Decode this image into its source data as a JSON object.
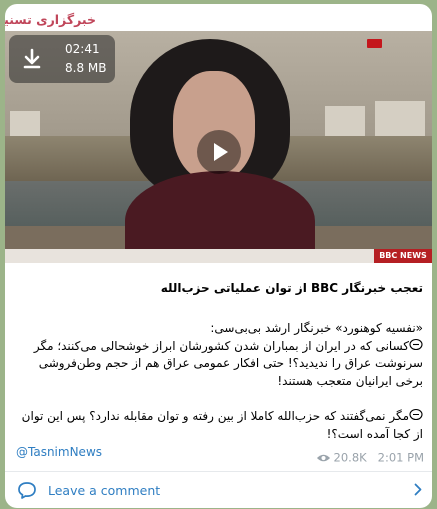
{
  "channel": {
    "name": "خبرگزاری تسنیم"
  },
  "video": {
    "duration": "02:41",
    "size": "8.8 MB",
    "news_brand": "BBC NEWS"
  },
  "post": {
    "headline": "تعجب خبرنگار BBC  از توان عملیاتی حزب‌الله",
    "intro": "«نفسیه کوهنورد» خبرنگار ارشد بی‌بی‌سی:",
    "paragraph1": "کسانی که در ایران از بمباران شدن کشورشان ابراز خوشحالی می‌کنند؛ مگر سرنوشت عراق را ندیدید؟! حتی افکار عمومی عراق هم از حجم وطن‌فروشی برخی ایرانیان متعجب هستند!",
    "paragraph2": "مگر نمی‌گفتند که حزب‌الله کاملا از بین رفته و توان مقابله ندارد؟ پس این توان از کجا آمده است؟!",
    "handle": "@TasnimNews",
    "views": "20.8K",
    "time": "2:01 PM"
  },
  "comment": {
    "label": "Leave a comment"
  },
  "colors": {
    "accent": "#2f7ec2",
    "channel": "#c0465a",
    "background": "#9cb489"
  }
}
